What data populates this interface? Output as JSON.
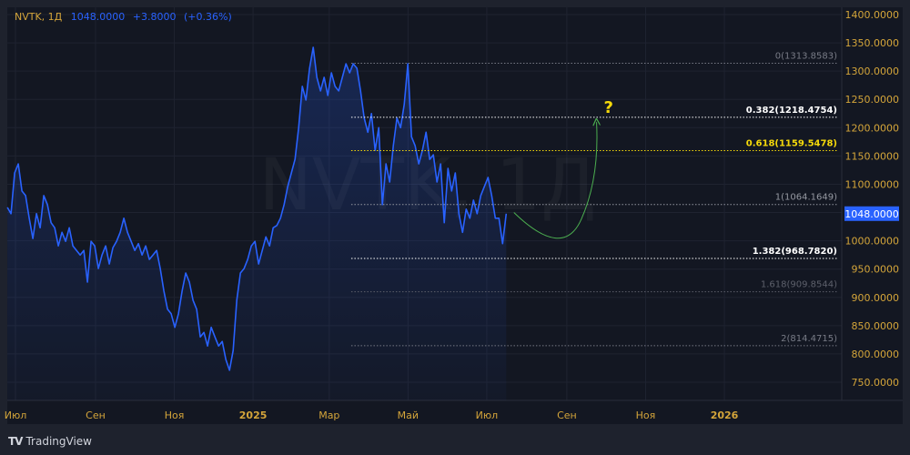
{
  "legend": {
    "symbol": "NVTK, 1Д",
    "price": "1048.0000",
    "change": "+3.8000",
    "change_pct": "(+0.36%)"
  },
  "watermark": "NVTK, 1Д",
  "footer": {
    "brand": "TradingView"
  },
  "annotation": {
    "question": "?"
  },
  "colors": {
    "line": "#2962ff",
    "axis_text": "#d4a53a",
    "projection": "#4caf50",
    "fib_highlight": "#f5d90a"
  },
  "chart_data": {
    "type": "line",
    "title": "NVTK, 1Д",
    "ylim": [
      750,
      1400
    ],
    "y_ticks": [
      "1400.0000",
      "1350.0000",
      "1300.0000",
      "1250.0000",
      "1200.0000",
      "1150.0000",
      "1100.0000",
      "1050.0000",
      "1000.0000",
      "950.0000",
      "900.0000",
      "850.0000",
      "800.0000",
      "750.0000"
    ],
    "y_tick_values": [
      1400,
      1350,
      1300,
      1250,
      1200,
      1150,
      1100,
      1050,
      1000,
      950,
      900,
      850,
      800,
      750
    ],
    "x_ticks": [
      {
        "label": "Июл",
        "day": 0
      },
      {
        "label": "Сен",
        "day": 62
      },
      {
        "label": "Ноя",
        "day": 123
      },
      {
        "label": "2025",
        "day": 184
      },
      {
        "label": "Мар",
        "day": 243
      },
      {
        "label": "Май",
        "day": 304
      },
      {
        "label": "Июл",
        "day": 365
      },
      {
        "label": "Сен",
        "day": 427
      },
      {
        "label": "Ноя",
        "day": 488
      },
      {
        "label": "2026",
        "day": 549
      }
    ],
    "x_unit": "days since 2024-07-01",
    "series_start_day": -6.3,
    "series_step_days": 2.82,
    "series": [
      {
        "name": "NVTK",
        "values": [
          1059,
          1048,
          1120,
          1136,
          1088,
          1080,
          1040,
          1004,
          1048,
          1023,
          1080,
          1064,
          1032,
          1023,
          991,
          1015,
          999,
          1023,
          991,
          983,
          975,
          983,
          927,
          999,
          991,
          951,
          975,
          991,
          959,
          988,
          999,
          1015,
          1040,
          1015,
          999,
          983,
          995,
          975,
          991,
          967,
          975,
          983,
          951,
          911,
          879,
          871,
          847,
          871,
          911,
          943,
          927,
          895,
          879,
          830,
          838,
          814,
          847,
          830,
          814,
          822,
          790,
          771,
          806,
          895,
          943,
          951,
          967,
          991,
          999,
          959,
          983,
          1007,
          991,
          1023,
          1027,
          1040,
          1064,
          1096,
          1120,
          1144,
          1200,
          1273,
          1249,
          1305,
          1342,
          1289,
          1265,
          1289,
          1257,
          1297,
          1273,
          1265,
          1289,
          1313,
          1297,
          1313,
          1305,
          1265,
          1217,
          1192,
          1225,
          1160,
          1200,
          1064,
          1136,
          1104,
          1168,
          1217,
          1200,
          1241,
          1313,
          1184,
          1168,
          1136,
          1160,
          1192,
          1144,
          1152,
          1104,
          1136,
          1032,
          1128,
          1088,
          1120,
          1048,
          1015,
          1056,
          1040,
          1072,
          1048,
          1080,
          1096,
          1112,
          1080,
          1040,
          1040,
          995,
          1048
        ]
      }
    ],
    "last_price": {
      "label": "1048.0000",
      "value": 1048
    },
    "fib_levels": [
      {
        "label": "0(1313.8583)",
        "value": 1313.8583,
        "color": "#787b86",
        "bold": false
      },
      {
        "label": "0.382(1218.4754)",
        "value": 1218.4754,
        "color": "#ffffff",
        "bold": true
      },
      {
        "label": "0.618(1159.5478)",
        "value": 1159.5478,
        "color": "#f5d90a",
        "bold": true
      },
      {
        "label": "1(1064.1649)",
        "value": 1064.1649,
        "color": "#9598a1",
        "bold": false
      },
      {
        "label": "1.382(968.7820)",
        "value": 968.782,
        "color": "#ffffff",
        "bold": true
      },
      {
        "label": "1.618(909.8544)",
        "value": 909.8544,
        "color": "#5d606b",
        "bold": false
      },
      {
        "label": "2(814.4715)",
        "value": 814.4715,
        "color": "#787b86",
        "bold": false
      }
    ],
    "fib_start_day": 260,
    "projection": {
      "points": [
        [
          386,
          1050
        ],
        [
          410,
          1030
        ],
        [
          450,
          1210
        ]
      ]
    }
  }
}
